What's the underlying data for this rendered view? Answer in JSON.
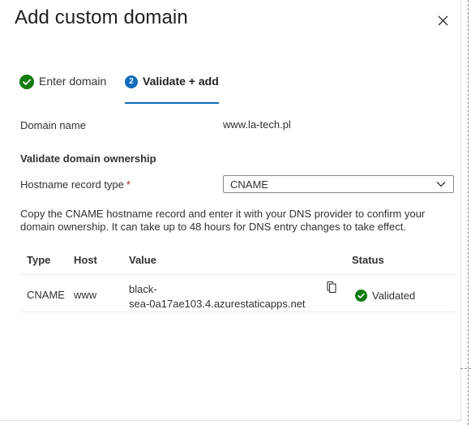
{
  "panel": {
    "title": "Add custom domain"
  },
  "steps": [
    {
      "label": "Enter domain",
      "state": "complete",
      "icon": "checkmark-circle-icon"
    },
    {
      "label": "Validate + add",
      "state": "active",
      "number": "2"
    }
  ],
  "domain": {
    "label": "Domain name",
    "value": "www.la-tech.pl"
  },
  "validate": {
    "section_title": "Validate domain ownership",
    "record_type_label": "Hostname record type",
    "required_mark": "*",
    "record_type_value": "CNAME",
    "help_text": "Copy the CNAME hostname record and enter it with your DNS provider to confirm your domain ownership. It can take up to 48 hours for DNS entry changes to take effect."
  },
  "table": {
    "headers": {
      "type": "Type",
      "host": "Host",
      "value": "Value",
      "status": "Status"
    },
    "rows": [
      {
        "type": "CNAME",
        "host": "www",
        "value": "black-sea-0a17ae103.4.azurestaticapps.net",
        "value_line1": "black-",
        "value_line2": "sea-0a17ae103.4.azurestaticapps.net",
        "status": "Validated"
      }
    ]
  },
  "colors": {
    "accent": "#0f6cbd",
    "success": "#107c10",
    "required": "#a4262c"
  }
}
